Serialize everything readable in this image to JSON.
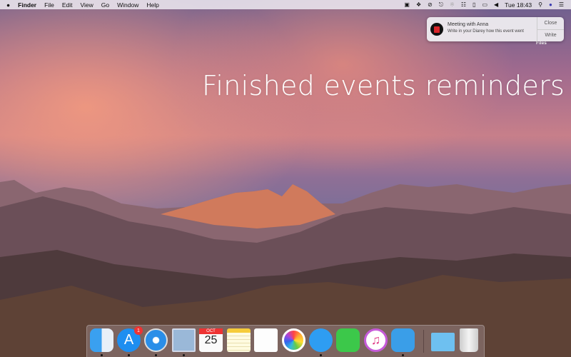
{
  "menubar": {
    "apple": "",
    "app": "Finder",
    "menus": [
      "File",
      "Edit",
      "View",
      "Go",
      "Window",
      "Help"
    ],
    "clock": "Tue 18:43",
    "status_icons": [
      "diary-icon",
      "dropbox-icon",
      "clock-icon",
      "sync-icon",
      "bluetooth-icon",
      "wifi-icon",
      "battery-icon",
      "airplay-icon",
      "volume-icon",
      "search-icon",
      "siri-icon",
      "notification-center-icon"
    ]
  },
  "headline": "Finished events reminders",
  "notification": {
    "title": "Meeting with Anna",
    "body": "Write in your Diarey how this event went",
    "close": "Close",
    "write": "Write"
  },
  "desktop_item": "Files",
  "dock": {
    "appstore_badge": "1",
    "calendar_month": "OCT",
    "calendar_day": "25",
    "items": [
      "Finder",
      "App Store",
      "Safari",
      "Mail",
      "Calendar",
      "Notes",
      "Reminders",
      "Photos",
      "Messages",
      "FaceTime",
      "iTunes",
      "Tweetbot",
      "Folder",
      "Trash"
    ]
  }
}
